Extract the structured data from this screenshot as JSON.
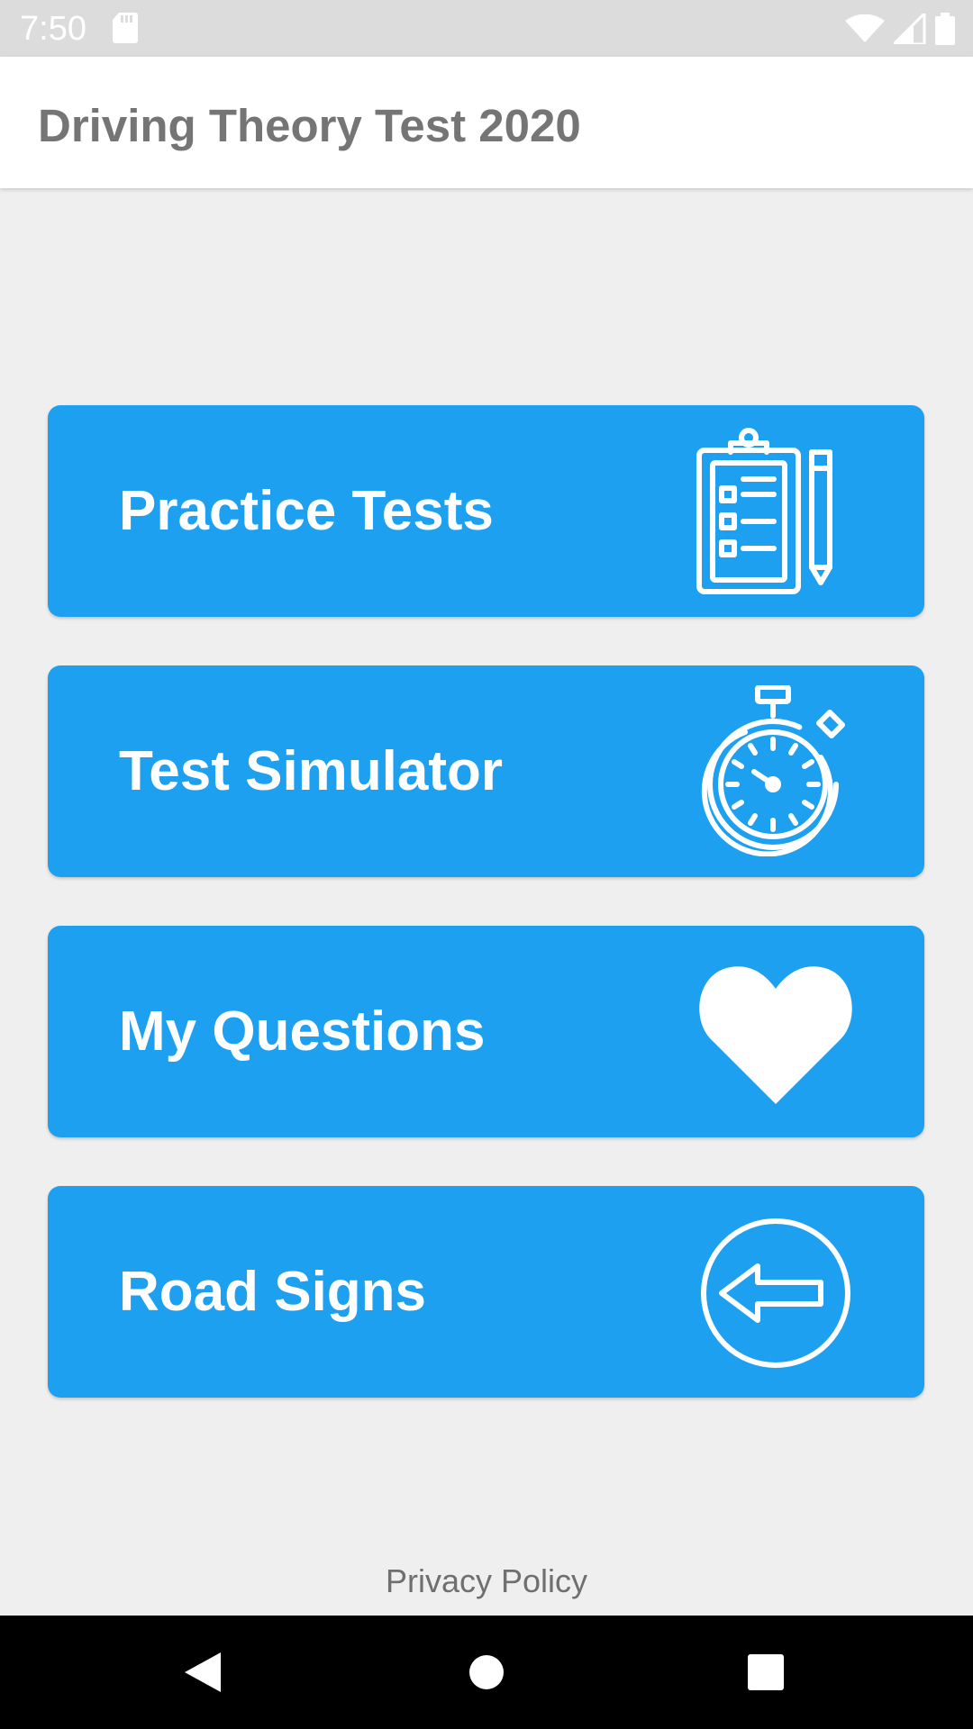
{
  "status_bar": {
    "time": "7:50",
    "icons": [
      "sd-card-icon",
      "wifi-icon",
      "signal-icon",
      "battery-icon"
    ]
  },
  "app_bar": {
    "title": "Driving Theory Test 2020"
  },
  "menu": {
    "items": [
      {
        "label": "Practice Tests",
        "icon": "clipboard-checklist-icon"
      },
      {
        "label": "Test Simulator",
        "icon": "stopwatch-icon"
      },
      {
        "label": "My Questions",
        "icon": "heart-icon"
      },
      {
        "label": "Road Signs",
        "icon": "left-arrow-sign-icon"
      }
    ]
  },
  "footer": {
    "privacy_label": "Privacy Policy"
  },
  "nav_bar": {
    "icons": [
      "back-icon",
      "home-icon",
      "recents-icon"
    ]
  },
  "colors": {
    "card": "#1ea0f0",
    "background": "#efefef",
    "status_bar": "#dcdcdc",
    "title_text": "#757575"
  }
}
